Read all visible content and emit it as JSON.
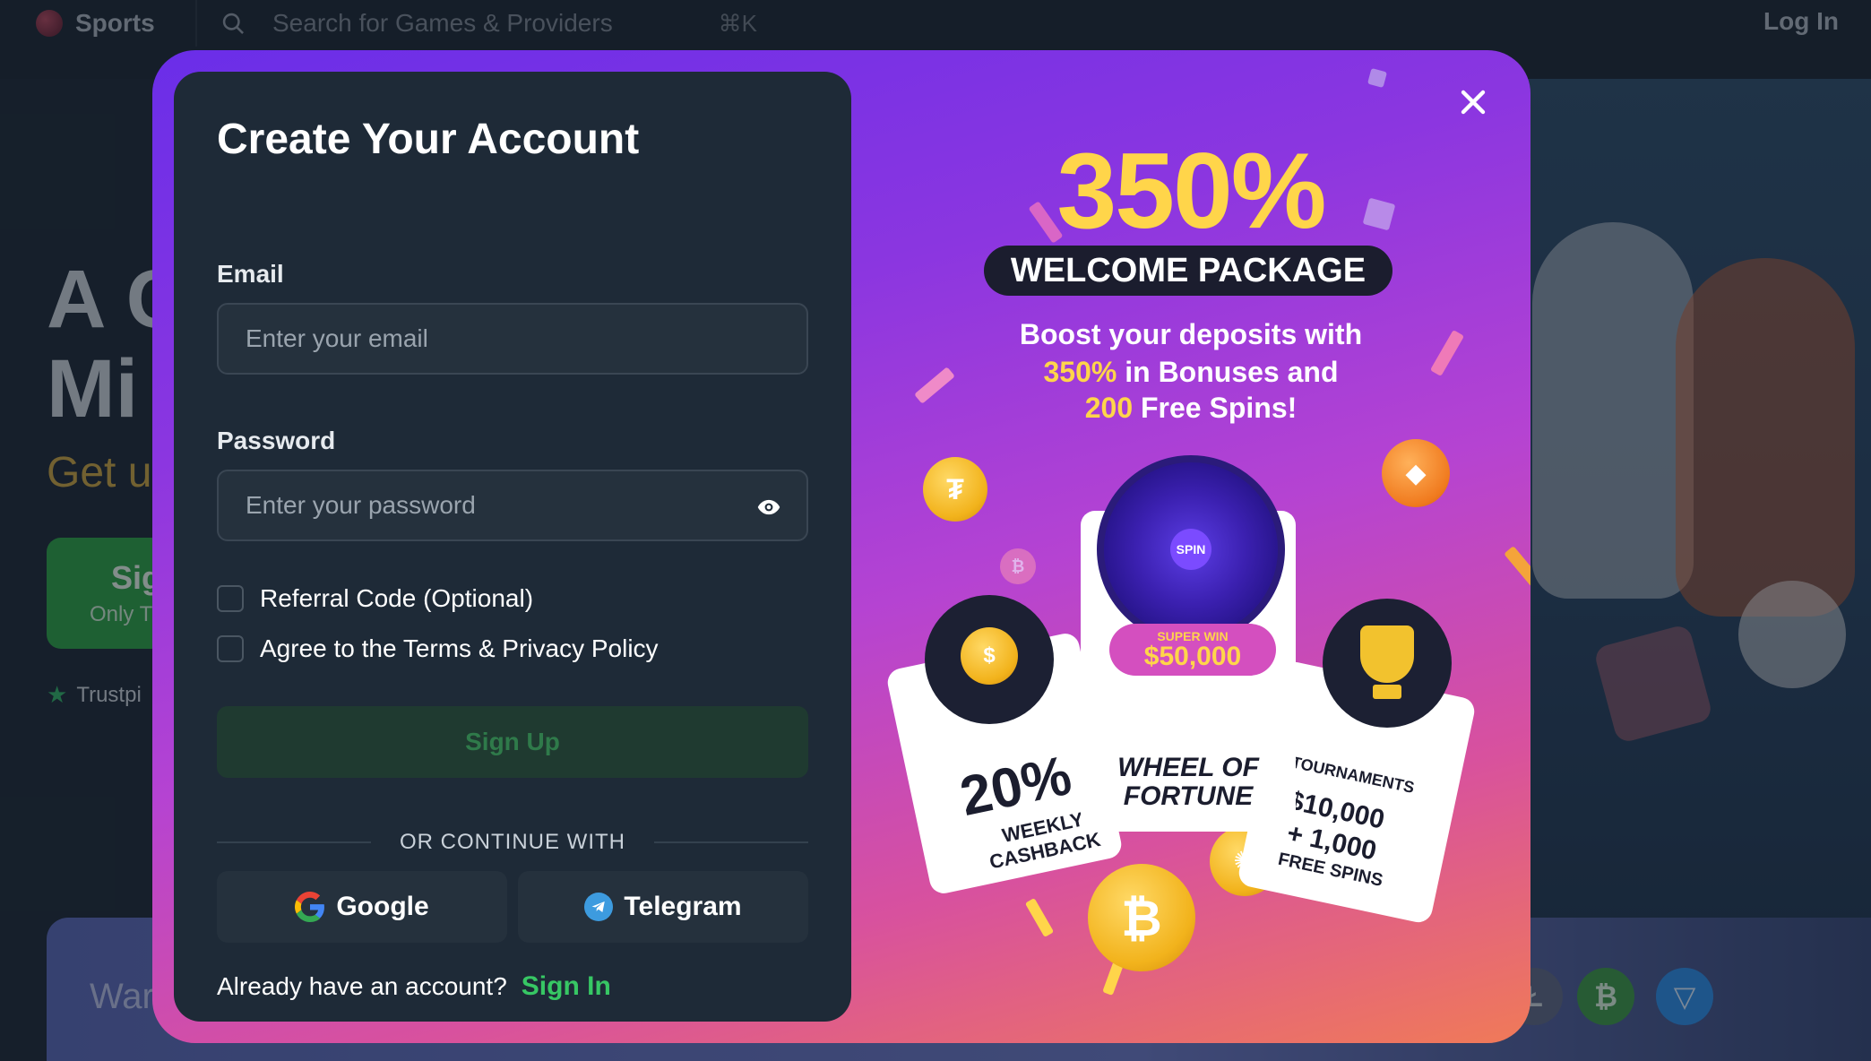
{
  "topbar": {
    "sports_label": "Sports",
    "search_placeholder": "Search for Games & Providers",
    "search_shortcut": "⌘K",
    "login_label": "Log In"
  },
  "hero": {
    "title_line1": "A C",
    "title_line2": "Mi",
    "subtitle": "Get u",
    "cta_title": "Sig",
    "cta_sub": "Only T",
    "trust_label": "Trustpi",
    "bottom_text": "War"
  },
  "modal": {
    "title": "Create Your Account",
    "email_label": "Email",
    "email_placeholder": "Enter your email",
    "email_value": "",
    "password_label": "Password",
    "password_placeholder": "Enter your password",
    "password_value": "",
    "referral_label": "Referral Code (Optional)",
    "referral_checked": false,
    "terms_label": "Agree to the Terms & Privacy Policy",
    "terms_checked": false,
    "signup_label": "Sign Up",
    "divider_text": "OR CONTINUE WITH",
    "google_label": "Google",
    "telegram_label": "Telegram",
    "already_text": "Already have an account?",
    "signin_label": "Sign In"
  },
  "promo": {
    "percent": "350%",
    "pill": "WELCOME PACKAGE",
    "desc_line1": "Boost your deposits with",
    "desc_line2_hl": "350%",
    "desc_line2_rest": " in Bonuses and",
    "desc_line3_hl": "200",
    "desc_line3_rest": " Free Spins!",
    "wheel_center": "SPIN",
    "super_win": "SUPER WIN",
    "super_amount": "$50,000",
    "wheel_title1": "WHEEL OF",
    "wheel_title2": "FORTUNE",
    "cashback_pct": "20%",
    "cashback_line1": "WEEKLY",
    "cashback_line2": "CASHBACK",
    "tour_label": "TOURNAMENTS",
    "tour_amount": "$10,000",
    "tour_plus": "+ 1,000",
    "tour_spins": "FREE SPINS"
  },
  "colors": {
    "accent_green": "#37c764",
    "promo_yellow": "#ffd54a",
    "card_bg": "#1e2a37"
  }
}
